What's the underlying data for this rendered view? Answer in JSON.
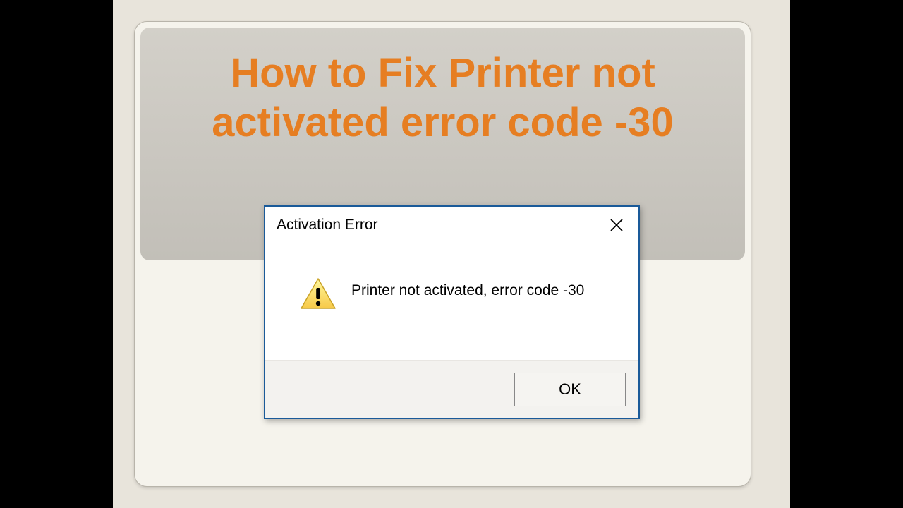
{
  "slide": {
    "title": "How to Fix Printer not activated error code -30"
  },
  "dialog": {
    "title": "Activation Error",
    "message": "Printer not activated, error code -30",
    "ok_label": "OK"
  }
}
